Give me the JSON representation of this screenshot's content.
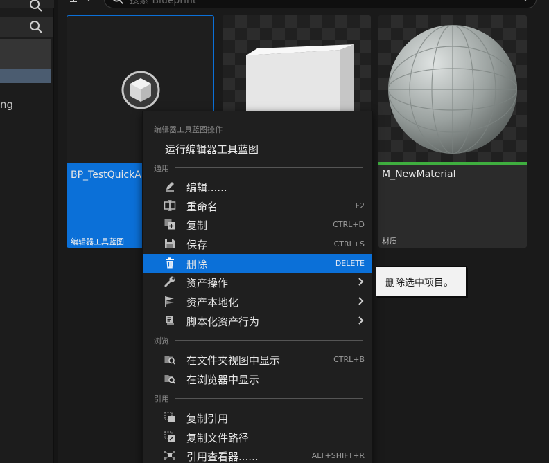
{
  "left_panel": {
    "partial_label": "ng"
  },
  "toolbar": {
    "search_placeholder": "搜索 Blueprint"
  },
  "assets": [
    {
      "name": "BP_TestQuickA",
      "type": "编辑器工具蓝图",
      "selected": true
    },
    {
      "name": "",
      "type": "",
      "selected": false
    },
    {
      "name": "M_NewMaterial",
      "type": "材质",
      "selected": false
    }
  ],
  "context_menu": {
    "sections": {
      "editor_utility": "编辑器工具蓝图操作",
      "common": "通用",
      "browse": "浏览",
      "references": "引用"
    },
    "run_editor_utility": "运行编辑器工具蓝图",
    "items": {
      "edit": {
        "label": "编辑......",
        "icon": "pencil-icon"
      },
      "rename": {
        "label": "重命名",
        "shortcut": "F2",
        "icon": "rename-icon"
      },
      "duplicate": {
        "label": "复制",
        "shortcut": "CTRL+D",
        "icon": "duplicate-icon"
      },
      "save": {
        "label": "保存",
        "shortcut": "CTRL+S",
        "icon": "save-icon"
      },
      "delete": {
        "label": "删除",
        "shortcut": "DELETE",
        "icon": "trash-icon"
      },
      "asset_actions": {
        "label": "资产操作",
        "icon": "wrench-icon"
      },
      "asset_localization": {
        "label": "资产本地化",
        "icon": "flag-icon"
      },
      "scripted_asset_actions": {
        "label": "脚本化资产行为",
        "icon": "script-icon"
      },
      "show_in_folder": {
        "label": "在文件夹视图中显示",
        "shortcut": "CTRL+B",
        "icon": "folder-search-icon"
      },
      "show_in_browser": {
        "label": "在浏览器中显示",
        "icon": "folder-search-icon"
      },
      "copy_reference": {
        "label": "复制引用",
        "icon": "copy-reference-icon"
      },
      "copy_file_path": {
        "label": "复制文件路径",
        "icon": "copy-path-icon"
      },
      "reference_viewer": {
        "label": "引用查看器......",
        "shortcut": "ALT+SHIFT+R",
        "icon": "reference-viewer-icon"
      }
    }
  },
  "tooltip": {
    "text": "删除选中项目。"
  },
  "colors": {
    "selection_blue": "#0b70d8",
    "material_bar_green": "#3fae3f",
    "panel_dark": "#1a1a1a",
    "menu_bg": "#1f1f1f"
  }
}
